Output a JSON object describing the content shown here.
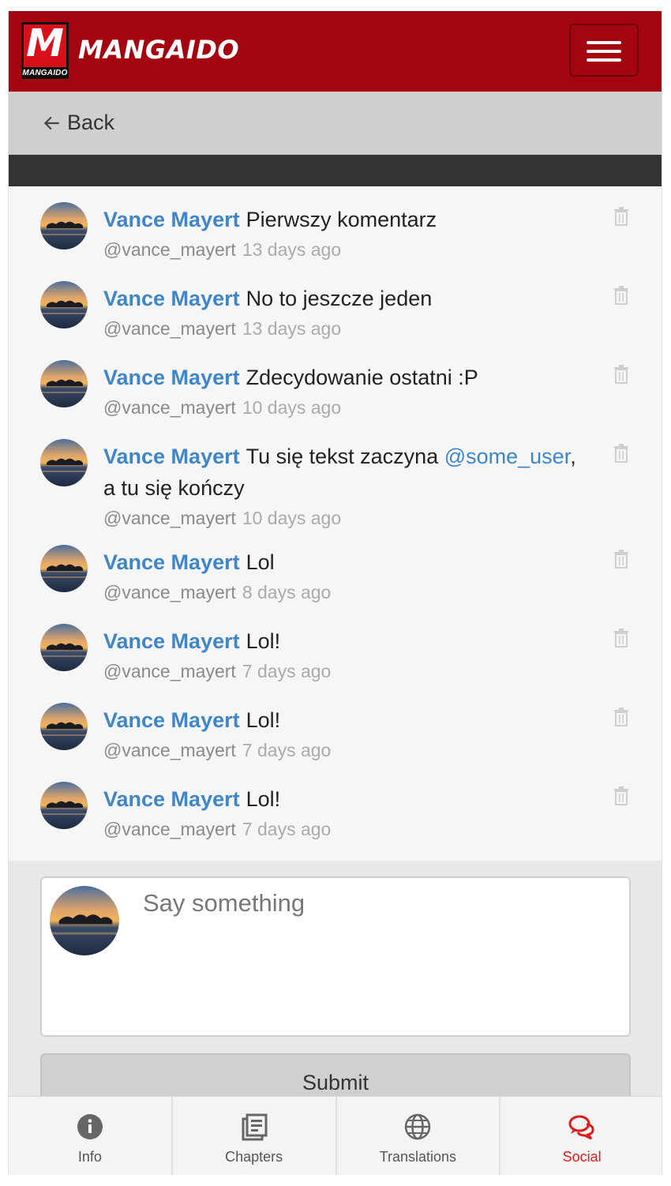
{
  "header": {
    "logo_letter": "M",
    "logo_small": "MANGAIDO",
    "brand": "MANGAIDO"
  },
  "back": {
    "label": "Back"
  },
  "comments": [
    {
      "name": "Vance Mayert",
      "text": "Pierwszy komentarz",
      "handle": "@vance_mayert",
      "time": "13 days ago"
    },
    {
      "name": "Vance Mayert",
      "text": "No to jeszcze jeden",
      "handle": "@vance_mayert",
      "time": "13 days ago"
    },
    {
      "name": "Vance Mayert",
      "text": "Zdecydowanie ostatni :P",
      "handle": "@vance_mayert",
      "time": "10 days ago"
    },
    {
      "name": "Vance Mayert",
      "text_before": "Tu się tekst zaczyna ",
      "mention": "@some_user",
      "text_after": ", a tu się kończy",
      "handle": "@vance_mayert",
      "time": "10 days ago"
    },
    {
      "name": "Vance Mayert",
      "text": "Lol",
      "handle": "@vance_mayert",
      "time": "8 days ago"
    },
    {
      "name": "Vance Mayert",
      "text": "Lol!",
      "handle": "@vance_mayert",
      "time": "7 days ago"
    },
    {
      "name": "Vance Mayert",
      "text": "Lol!",
      "handle": "@vance_mayert",
      "time": "7 days ago"
    },
    {
      "name": "Vance Mayert",
      "text": "Lol!",
      "handle": "@vance_mayert",
      "time": "7 days ago"
    }
  ],
  "composer": {
    "placeholder": "Say something",
    "submit_label": "Submit"
  },
  "nav": [
    {
      "label": "Info",
      "icon": "info-icon"
    },
    {
      "label": "Chapters",
      "icon": "chapters-icon"
    },
    {
      "label": "Translations",
      "icon": "globe-icon"
    },
    {
      "label": "Social",
      "icon": "chat-bubbles-icon",
      "active": true
    }
  ],
  "colors": {
    "header": "#a4040f",
    "link": "#3f86c9",
    "active_nav": "#e01b1b"
  }
}
